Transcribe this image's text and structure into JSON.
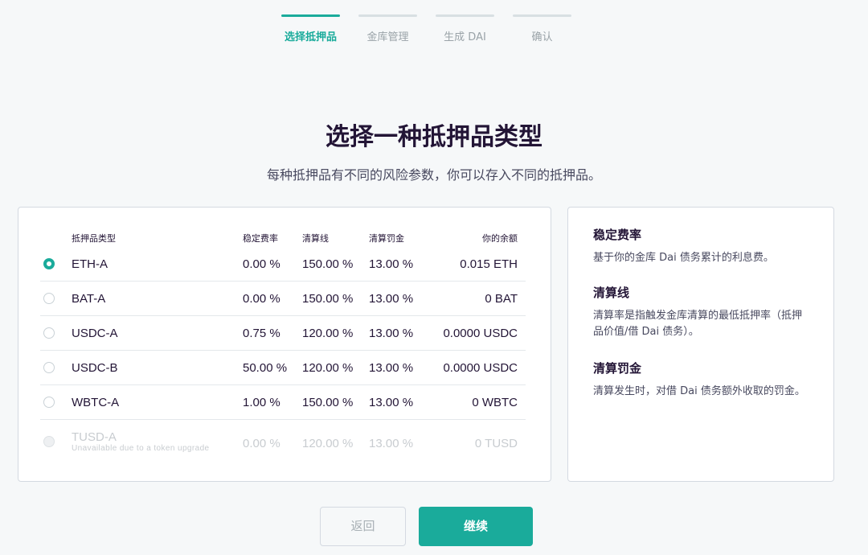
{
  "stepper": {
    "steps": [
      {
        "label": "选择抵押品",
        "active": true
      },
      {
        "label": "金库管理",
        "active": false
      },
      {
        "label": "生成 DAI",
        "active": false
      },
      {
        "label": "确认",
        "active": false
      }
    ]
  },
  "title": "选择一种抵押品类型",
  "subtitle": "每种抵押品有不同的风险参数，你可以存入不同的抵押品。",
  "table": {
    "headers": {
      "type": "抵押品类型",
      "stability_fee": "稳定费率",
      "liquidation_ratio": "清算线",
      "liquidation_penalty": "清算罚金",
      "balance": "你的余额"
    },
    "rows": [
      {
        "name": "ETH-A",
        "stability_fee": "0.00 %",
        "liquidation_ratio": "150.00 %",
        "liquidation_penalty": "13.00 %",
        "balance": "0.015 ETH",
        "selected": true,
        "disabled": false,
        "note": ""
      },
      {
        "name": "BAT-A",
        "stability_fee": "0.00 %",
        "liquidation_ratio": "150.00 %",
        "liquidation_penalty": "13.00 %",
        "balance": "0 BAT",
        "selected": false,
        "disabled": false,
        "note": ""
      },
      {
        "name": "USDC-A",
        "stability_fee": "0.75 %",
        "liquidation_ratio": "120.00 %",
        "liquidation_penalty": "13.00 %",
        "balance": "0.0000 USDC",
        "selected": false,
        "disabled": false,
        "note": ""
      },
      {
        "name": "USDC-B",
        "stability_fee": "50.00 %",
        "liquidation_ratio": "120.00 %",
        "liquidation_penalty": "13.00 %",
        "balance": "0.0000 USDC",
        "selected": false,
        "disabled": false,
        "note": ""
      },
      {
        "name": "WBTC-A",
        "stability_fee": "1.00 %",
        "liquidation_ratio": "150.00 %",
        "liquidation_penalty": "13.00 %",
        "balance": "0 WBTC",
        "selected": false,
        "disabled": false,
        "note": ""
      },
      {
        "name": "TUSD-A",
        "stability_fee": "0.00 %",
        "liquidation_ratio": "120.00 %",
        "liquidation_penalty": "13.00 %",
        "balance": "0 TUSD",
        "selected": false,
        "disabled": true,
        "note": "Unavailable due to a token upgrade"
      }
    ]
  },
  "info": {
    "stability_fee_title": "稳定费率",
    "stability_fee_text": "基于你的金库 Dai 债务累计的利息费。",
    "liquidation_ratio_title": "清算线",
    "liquidation_ratio_text": "清算率是指触发金库清算的最低抵押率（抵押品价值/借 Dai 债务）。",
    "liquidation_penalty_title": "清算罚金",
    "liquidation_penalty_text": "清算发生时，对借 Dai 债务额外收取的罚金。"
  },
  "buttons": {
    "back": "返回",
    "continue": "继续"
  },
  "colors": {
    "accent": "#1aab9b",
    "text": "#231536",
    "muted": "#48495f",
    "disabled": "#c8ccd0"
  }
}
